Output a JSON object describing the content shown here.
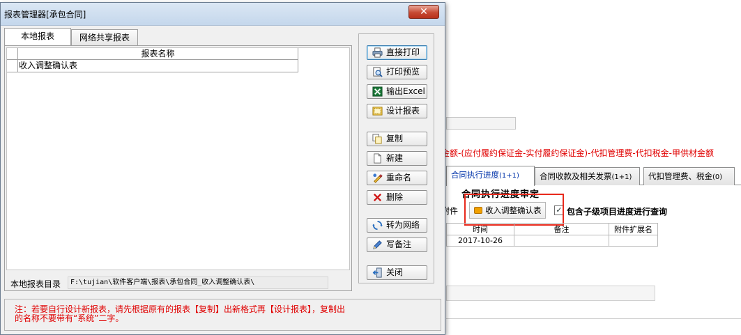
{
  "dialog": {
    "title": "报表管理器[承包合同]",
    "close_glyph": "✕",
    "tabs": [
      {
        "label": "本地报表"
      },
      {
        "label": "网络共享报表"
      }
    ],
    "grid": {
      "column_header": "报表名称",
      "rows": [
        {
          "name": "收入调整确认表"
        }
      ]
    },
    "directory": {
      "label": "本地报表目录",
      "value": "F:\\tujian\\软件客户端\\报表\\承包合同_收入调整确认表\\"
    },
    "buttons": [
      {
        "label": "直接打印",
        "icon": "printer-icon"
      },
      {
        "label": "打印预览",
        "icon": "print-preview-icon"
      },
      {
        "label": "输出Excel",
        "icon": "excel-icon"
      },
      {
        "label": "设计报表",
        "icon": "design-report-icon"
      },
      {
        "label": "复制",
        "icon": "copy-icon"
      },
      {
        "label": "新建",
        "icon": "new-document-icon"
      },
      {
        "label": "重命名",
        "icon": "rename-icon"
      },
      {
        "label": "删除",
        "icon": "delete-icon"
      },
      {
        "label": "转为网络",
        "icon": "network-icon"
      },
      {
        "label": "写备注",
        "icon": "write-note-icon"
      },
      {
        "label": "关闭",
        "icon": "exit-icon"
      }
    ],
    "note_line1": "注：若要自行设计新报表，请先根据原有的报表【复制】出新格式再【设计报表】，复制出",
    "note_line2": "的名称不要带有“系统”二字。"
  },
  "background": {
    "formula": "金额-(应付履约保证金-实付履约保证金)-代扣管理费-代扣税金-甲供材金额",
    "tabs": [
      {
        "label": "合同执行进度",
        "count": "(1+1)"
      },
      {
        "label": "合同收款及相关发票",
        "count": "(1+1)"
      },
      {
        "label": "代扣管理费、税金",
        "count": "(0)"
      }
    ],
    "section_title": "合同执行进度审定",
    "attach_label": "附件",
    "confirm_button": "收入调整确认表",
    "include_sub_label": "包含子级项目进度进行查询",
    "include_sub_checked": true,
    "check_glyph": "✓",
    "table": {
      "headers": [
        "时间",
        "备注",
        "附件扩展名"
      ],
      "rows": [
        [
          "2017-10-26",
          "",
          ""
        ]
      ]
    }
  },
  "colors": {
    "note_text": "#e00000",
    "highlight_box": "#e8291c",
    "close_button": "#c74a34"
  }
}
